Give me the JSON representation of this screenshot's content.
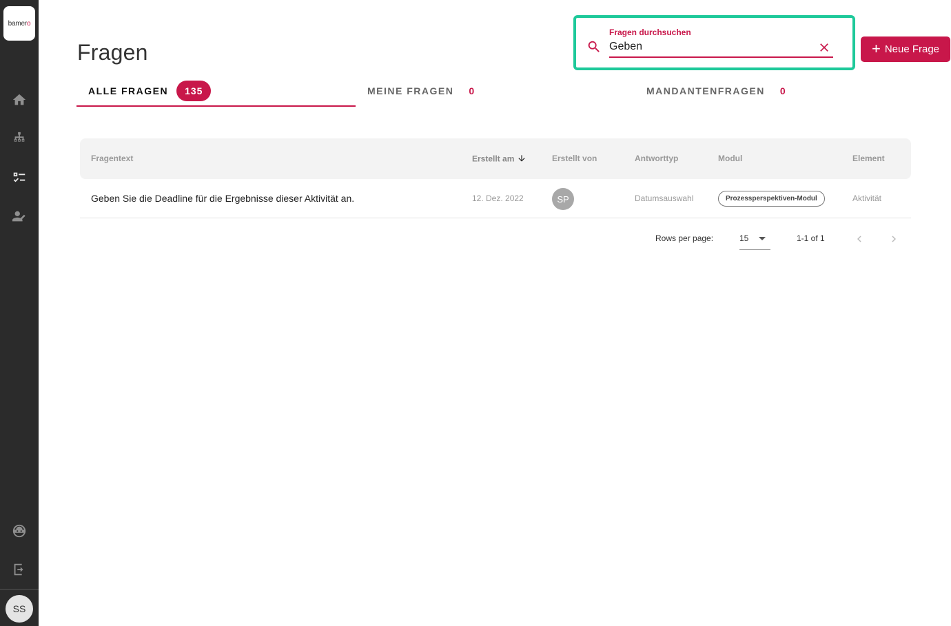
{
  "app": {
    "logo_text_main": "bamer",
    "logo_text_accent": "o",
    "user_initials": "SS"
  },
  "sidebar": {
    "items": [
      {
        "icon": "home-icon"
      },
      {
        "icon": "hierarchy-icon"
      },
      {
        "icon": "checklist-icon"
      },
      {
        "icon": "edit-person-icon"
      },
      {
        "icon": "support-icon"
      },
      {
        "icon": "logout-icon"
      }
    ]
  },
  "header": {
    "title": "Fragen",
    "new_button_label": "Neue Frage"
  },
  "search": {
    "label": "Fragen durchsuchen",
    "value": "Geben"
  },
  "tabs": [
    {
      "label": "ALLE FRAGEN",
      "count": "135"
    },
    {
      "label": "MEINE FRAGEN",
      "count": "0"
    },
    {
      "label": "MANDANTENFRAGEN",
      "count": "0"
    }
  ],
  "table": {
    "columns": [
      "Fragentext",
      "Erstellt am",
      "Erstellt von",
      "Antworttyp",
      "Modul",
      "Element"
    ],
    "rows": [
      {
        "text": "Geben Sie die Deadline für die Ergebnisse dieser Aktivität an.",
        "created_at": "12. Dez. 2022",
        "created_by": "SP",
        "answer_type": "Datumsauswahl",
        "module": "Prozessperspektiven-Modul",
        "element": "Aktivität"
      }
    ]
  },
  "pagination": {
    "rows_per_page_label": "Rows per page:",
    "rows_per_page": "15",
    "range": "1-1 of 1"
  },
  "colors": {
    "accent": "#c8174a",
    "highlight": "#1ec99a",
    "sidebar": "#2b2b2b"
  }
}
